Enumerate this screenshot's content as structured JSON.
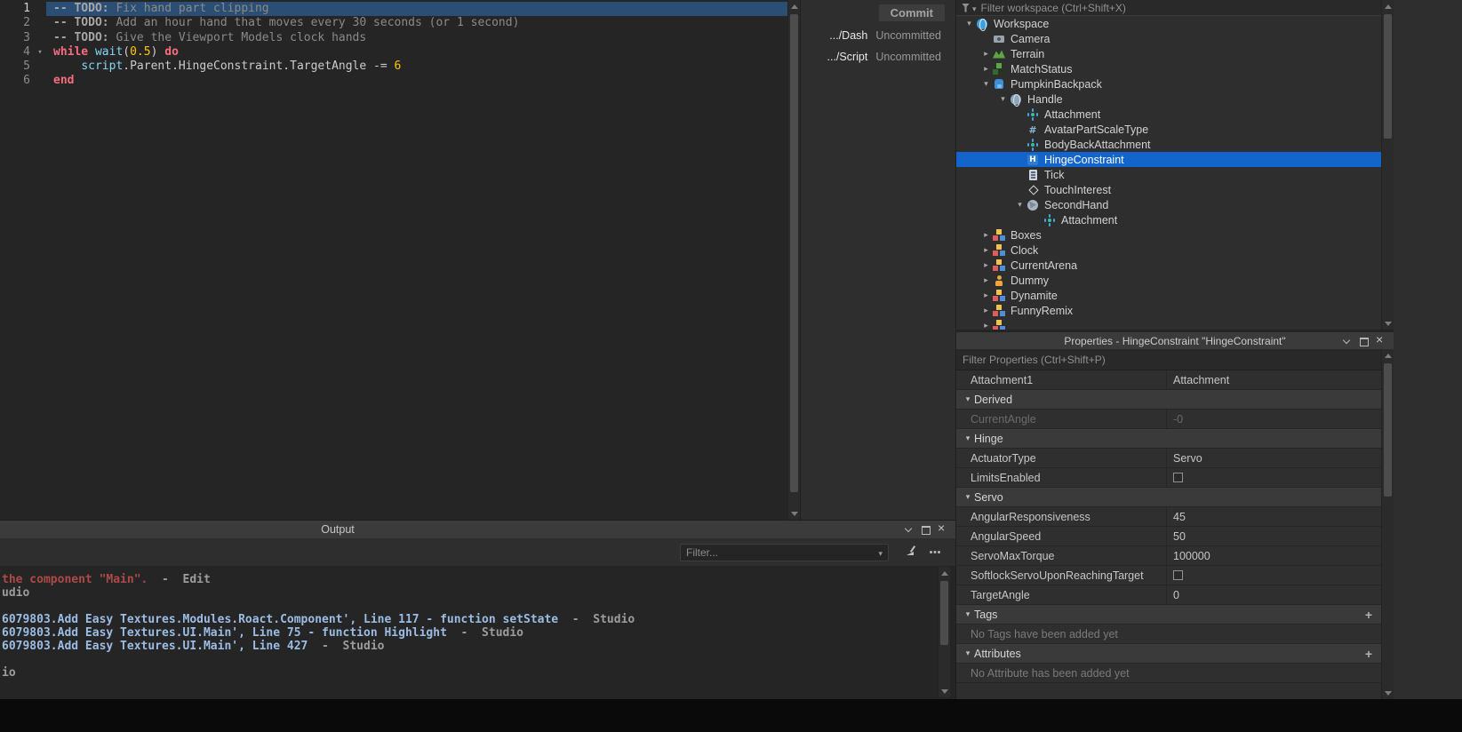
{
  "editor": {
    "lines": [
      {
        "num": "1",
        "segs": [
          "-- TODO:",
          " Fix hand part clipping"
        ]
      },
      {
        "num": "2",
        "segs": [
          "-- TODO:",
          " Add an hour hand that moves every 30 seconds (or 1 second)"
        ]
      },
      {
        "num": "3",
        "segs": [
          "-- TODO:",
          " Give the Viewport Models clock hands"
        ]
      },
      {
        "num": "4",
        "segs": [
          "while",
          " ",
          "wait",
          "(",
          "0.5",
          ") ",
          "do"
        ]
      },
      {
        "num": "5",
        "segs": [
          "    ",
          "script",
          ".Parent.HingeConstraint.TargetAngle -= ",
          "6"
        ]
      },
      {
        "num": "6",
        "segs": [
          "end"
        ]
      }
    ]
  },
  "commit": {
    "button": "Commit",
    "rows": [
      {
        "name": ".../Dash",
        "status": "Uncommitted"
      },
      {
        "name": ".../Script",
        "status": "Uncommitted"
      }
    ]
  },
  "explorer": {
    "filter_placeholder": "Filter workspace (Ctrl+Shift+X)",
    "items": [
      {
        "label": "Workspace"
      },
      {
        "label": "Camera"
      },
      {
        "label": "Terrain"
      },
      {
        "label": "MatchStatus"
      },
      {
        "label": "PumpkinBackpack"
      },
      {
        "label": "Handle"
      },
      {
        "label": "Attachment"
      },
      {
        "label": "AvatarPartScaleType"
      },
      {
        "label": "BodyBackAttachment"
      },
      {
        "label": "HingeConstraint"
      },
      {
        "label": "Tick"
      },
      {
        "label": "TouchInterest"
      },
      {
        "label": "SecondHand"
      },
      {
        "label": "Attachment"
      },
      {
        "label": "Boxes"
      },
      {
        "label": "Clock"
      },
      {
        "label": "CurrentArena"
      },
      {
        "label": "Dummy"
      },
      {
        "label": "Dynamite"
      },
      {
        "label": "FunnyRemix"
      },
      {
        "label": ""
      }
    ]
  },
  "properties": {
    "title": "Properties - HingeConstraint \"HingeConstraint\"",
    "filter_placeholder": "Filter Properties (Ctrl+Shift+P)",
    "rows": {
      "attachment1": {
        "name": "Attachment1",
        "value": "Attachment"
      },
      "derived": {
        "label": "Derived"
      },
      "current_angle": {
        "name": "CurrentAngle",
        "value": "-0"
      },
      "hinge": {
        "label": "Hinge"
      },
      "actuator_type": {
        "name": "ActuatorType",
        "value": "Servo"
      },
      "limits_enabled": {
        "name": "LimitsEnabled"
      },
      "servo": {
        "label": "Servo"
      },
      "angular_responsiveness": {
        "name": "AngularResponsiveness",
        "value": "45"
      },
      "angular_speed": {
        "name": "AngularSpeed",
        "value": "50"
      },
      "servo_max_torque": {
        "name": "ServoMaxTorque",
        "value": "100000"
      },
      "softlock": {
        "name": "SoftlockServoUponReachingTarget"
      },
      "target_angle": {
        "name": "TargetAngle",
        "value": "0"
      },
      "tags": {
        "label": "Tags",
        "empty": "No Tags have been added yet"
      },
      "attributes": {
        "label": "Attributes",
        "empty": "No Attribute has been added yet"
      }
    }
  },
  "output": {
    "title": "Output",
    "filter_placeholder": "Filter...",
    "lines": [
      {
        "segs": [
          "the component \"Main\".",
          "  -  Edit"
        ]
      },
      {
        "segs": [
          "udio"
        ]
      },
      {
        "segs": [
          ""
        ]
      },
      {
        "segs": [
          "6079803.Add Easy Textures.Modules.Roact.Component', Line 117 - function setState",
          "  -  Studio"
        ]
      },
      {
        "segs": [
          "6079803.Add Easy Textures.UI.Main', Line 75 - function Highlight",
          "  -  Studio"
        ]
      },
      {
        "segs": [
          "6079803.Add Easy Textures.UI.Main', Line 427",
          "  -  Studio"
        ]
      },
      {
        "segs": [
          ""
        ]
      },
      {
        "segs": [
          "io"
        ]
      }
    ]
  }
}
